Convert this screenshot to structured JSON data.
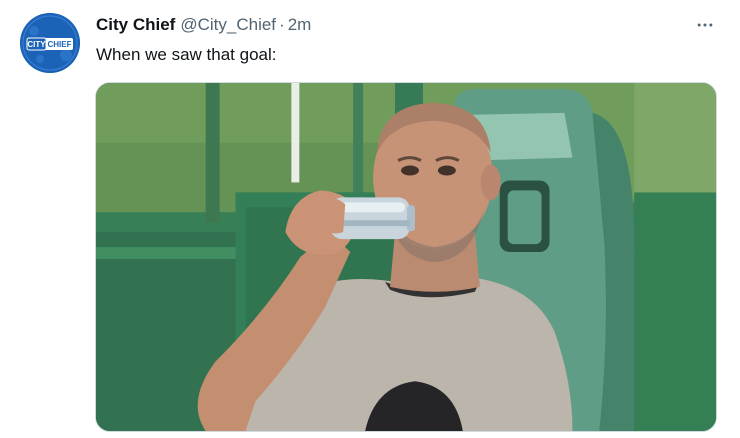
{
  "tweet": {
    "author": {
      "display_name": "City Chief",
      "handle": "@City_Chief",
      "avatar_text": "CITY CHIEF"
    },
    "separator": "·",
    "timestamp": "2m",
    "text": "When we saw that goal:",
    "more_icon": "more-horizontal-icon",
    "media": {
      "type": "photo",
      "description_icon": "photo"
    }
  },
  "colors": {
    "name": "#0f1419",
    "secondary": "#536471",
    "avatar_bg": "#1c63b8",
    "media_border": "#cfd9de"
  }
}
